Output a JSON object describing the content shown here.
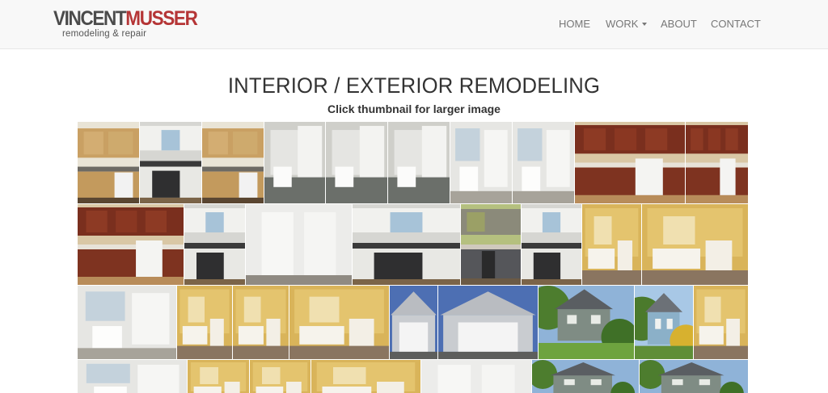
{
  "brand": {
    "name_first": "VINCENT",
    "name_last": "MUSSER",
    "tagline": "remodeling & repair",
    "colors": {
      "first": "#4b4b4b",
      "last": "#b53536"
    }
  },
  "nav": {
    "items": [
      {
        "label": "HOME"
      },
      {
        "label": "WORK",
        "has_dropdown": true
      },
      {
        "label": "ABOUT"
      },
      {
        "label": "CONTACT"
      }
    ]
  },
  "page": {
    "title": "INTERIOR / EXTERIOR REMODELING",
    "subtitle": "Click thumbnail for larger image"
  },
  "gallery": {
    "thumbnails": [
      {
        "theme": "kitchen-wood"
      },
      {
        "theme": "kitchen-white"
      },
      {
        "theme": "kitchen-wood"
      },
      {
        "theme": "bath-tile"
      },
      {
        "theme": "bath-tile"
      },
      {
        "theme": "bath-tile"
      },
      {
        "theme": "bath-white"
      },
      {
        "theme": "bath-white"
      },
      {
        "theme": "kitchen-cherry"
      },
      {
        "theme": "kitchen-cherry"
      },
      {
        "theme": "kitchen-cherry"
      },
      {
        "theme": "kitchen-white"
      },
      {
        "theme": "room-white"
      },
      {
        "theme": "kitchen-white"
      },
      {
        "theme": "kitchen-green"
      },
      {
        "theme": "kitchen-white"
      },
      {
        "theme": "bath-yellow"
      },
      {
        "theme": "bath-yellow"
      },
      {
        "theme": "bath-white"
      },
      {
        "theme": "bath-yellow"
      },
      {
        "theme": "bath-yellow"
      },
      {
        "theme": "bath-yellow"
      },
      {
        "theme": "garage"
      },
      {
        "theme": "garage"
      },
      {
        "theme": "house-green"
      },
      {
        "theme": "house-blue"
      },
      {
        "theme": "bath-yellow"
      },
      {
        "theme": "bath-white"
      },
      {
        "theme": "bath-yellow"
      },
      {
        "theme": "bath-yellow"
      },
      {
        "theme": "bath-yellow"
      },
      {
        "theme": "room-white"
      },
      {
        "theme": "house-green"
      },
      {
        "theme": "house-green"
      },
      {
        "theme": "house-green"
      }
    ]
  }
}
